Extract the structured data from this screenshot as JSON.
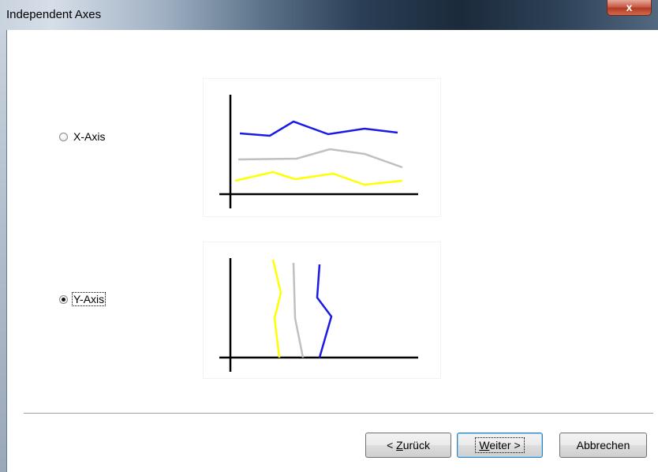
{
  "window": {
    "title": "Independent Axes",
    "close_label": "x"
  },
  "options": {
    "x_axis": {
      "label": "X-Axis",
      "checked": false
    },
    "y_axis": {
      "label": "Y-Axis",
      "checked": true
    }
  },
  "buttons": {
    "back": {
      "label": "< Zurück",
      "prefix": "< ",
      "mnemonic": "Z",
      "rest": "urück"
    },
    "next": {
      "label": "Weiter >",
      "mnemonic": "W",
      "rest": "eiter >"
    },
    "cancel": {
      "label": "Abbrechen"
    }
  },
  "colors": {
    "series_1": "#1a1ae6",
    "series_2": "#c0c0c0",
    "series_3": "#ffff00",
    "axis": "#000000"
  },
  "icons": {
    "close": "close-icon",
    "x_axis_preview": "x-axis-chart-preview",
    "y_axis_preview": "y-axis-chart-preview"
  }
}
